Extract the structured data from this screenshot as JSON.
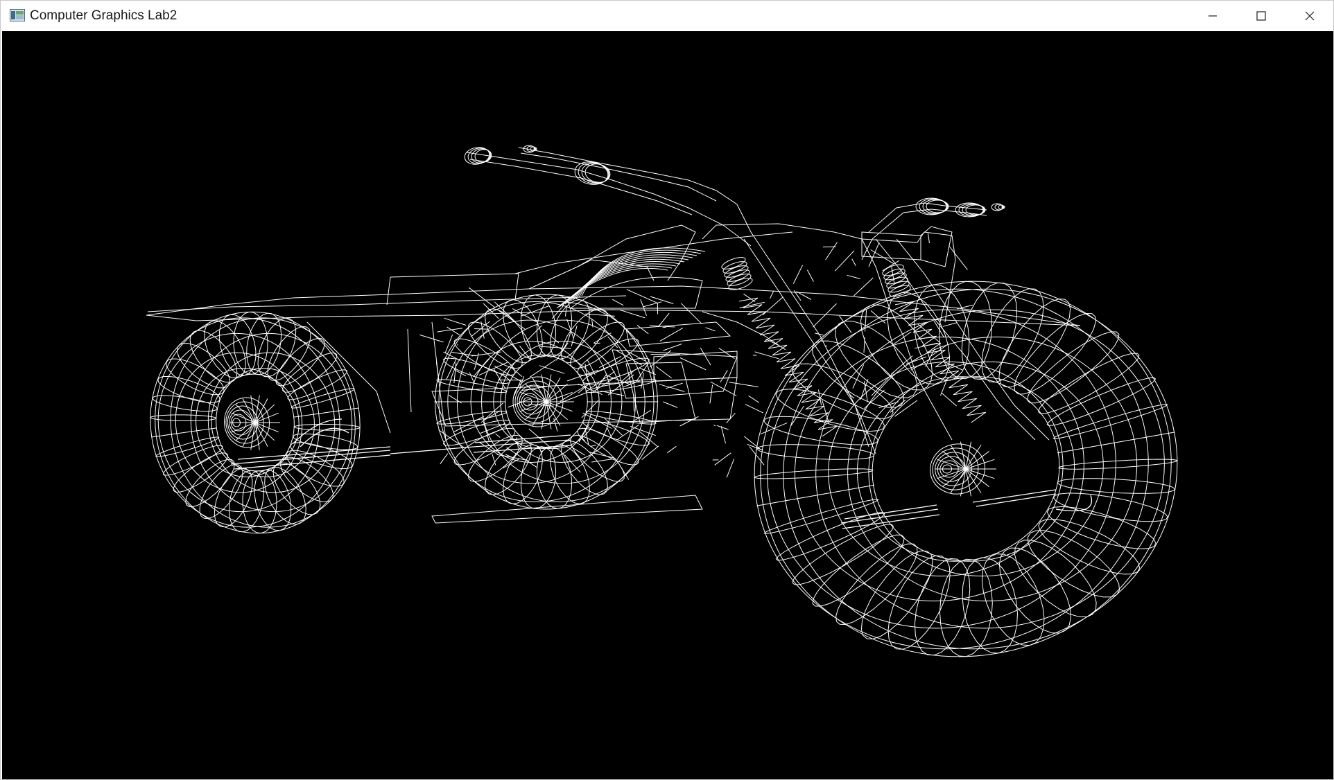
{
  "window": {
    "title": "Computer Graphics Lab2",
    "controls": [
      "minimize",
      "maximize",
      "close"
    ]
  },
  "viewport": {
    "background": "#000000",
    "line_color": "#ffffff",
    "render_mode": "wireframe",
    "model": "motorcycle"
  },
  "icons": {
    "app": "window-app-icon",
    "minimize": "minimize-icon",
    "maximize": "maximize-icon",
    "close": "close-icon"
  }
}
